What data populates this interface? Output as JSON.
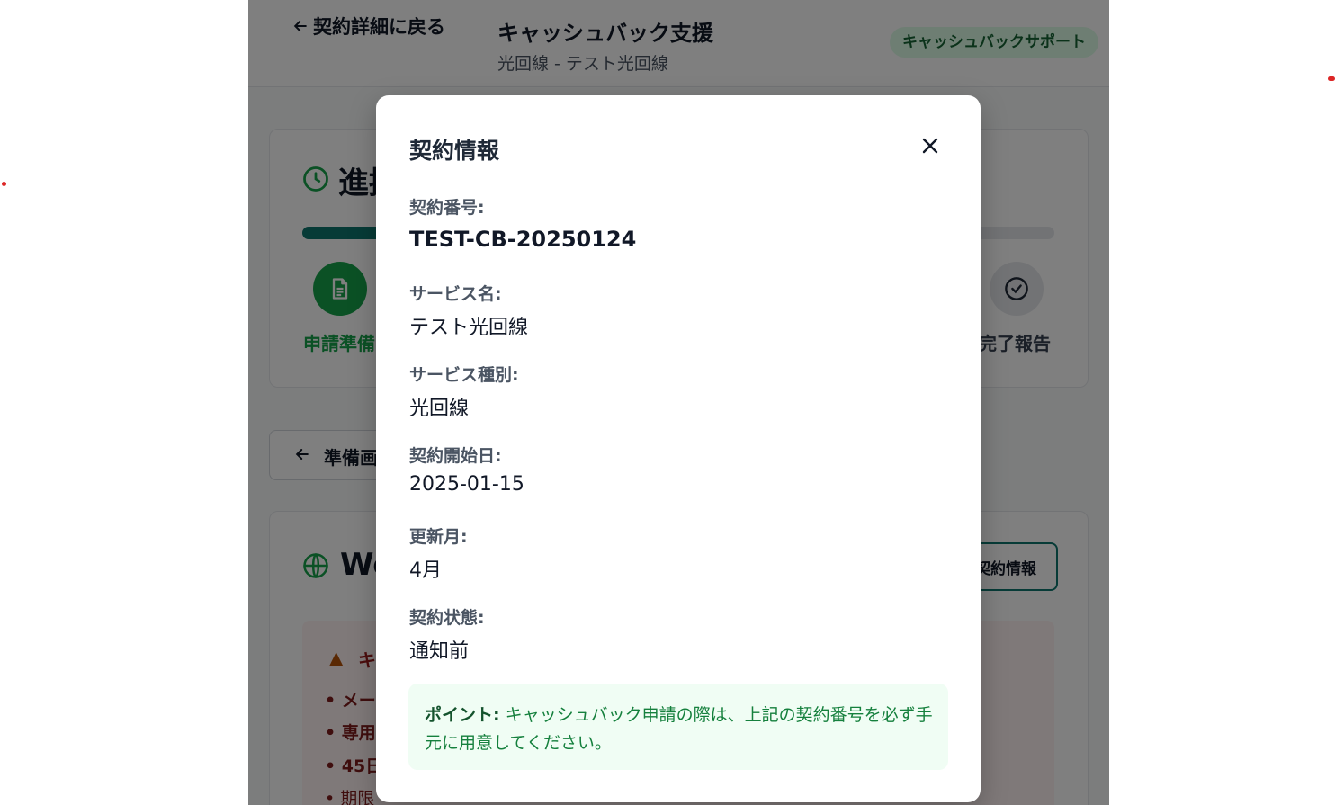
{
  "header": {
    "back_label": "契約詳細に戻る",
    "title": "キャッシュバック支援",
    "subtitle": "光回線 - テスト光回線",
    "badge": "キャッシュバックサポート"
  },
  "progress": {
    "title": "進捗",
    "fraction": 0.45,
    "steps": [
      {
        "label": "申請準備",
        "icon": "document-icon",
        "state": "active"
      },
      {
        "label": "完了報告",
        "icon": "check-circle-icon",
        "state": "pending"
      }
    ]
  },
  "nav": {
    "prev_label": "準備画面"
  },
  "web": {
    "title": "Web",
    "contract_btn_label": "契約情報",
    "alert_head": "キ",
    "alert_lines": [
      "• メール",
      "• 専用",
      "• 45日",
      "• 期限"
    ]
  },
  "modal": {
    "title": "契約情報",
    "fields": [
      {
        "label": "契約番号:",
        "value": "TEST-CB-20250124"
      },
      {
        "label": "サービス名:",
        "value": "テスト光回線"
      },
      {
        "label": "サービス種別:",
        "value": "光回線"
      },
      {
        "label": "契約開始日:",
        "value": "2025-01-15"
      },
      {
        "label": "更新月:",
        "value": "4月"
      },
      {
        "label": "契約状態:",
        "value": "通知前"
      }
    ],
    "point_label": "ポイント:",
    "point_text": " キャッシュバック申請の際は、上記の契約番号を必ず手元に用意してください。"
  },
  "colors": {
    "accent": "#0f766e",
    "success": "#16a34a",
    "badge_bg": "#dcfce7",
    "point_bg": "#f0fdf4"
  }
}
